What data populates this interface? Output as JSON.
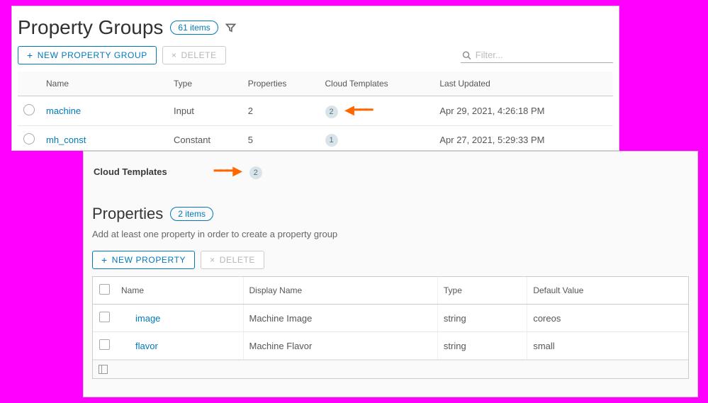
{
  "top": {
    "title": "Property Groups",
    "count_label": "61 items",
    "buttons": {
      "new_label": "NEW PROPERTY GROUP",
      "delete_label": "DELETE"
    },
    "filter_placeholder": "Filter...",
    "columns": {
      "name": "Name",
      "type": "Type",
      "props": "Properties",
      "templates": "Cloud Templates",
      "updated": "Last Updated"
    },
    "rows": [
      {
        "name": "machine",
        "type": "Input",
        "props": "2",
        "templates": "2",
        "updated": "Apr 29, 2021, 4:26:18 PM",
        "arrow": true
      },
      {
        "name": "mh_const",
        "type": "Constant",
        "props": "5",
        "templates": "1",
        "updated": "Apr 27, 2021, 5:29:33 PM",
        "arrow": false
      }
    ]
  },
  "detail": {
    "cloud_templates_label": "Cloud Templates",
    "cloud_templates_count": "2",
    "props_title": "Properties",
    "props_count_label": "2 items",
    "subtext": "Add at least one property in order to create a property group",
    "buttons": {
      "new_label": "NEW PROPERTY",
      "delete_label": "DELETE"
    },
    "columns": {
      "name": "Name",
      "display": "Display Name",
      "type": "Type",
      "default": "Default Value"
    },
    "rows": [
      {
        "name": "image",
        "display": "Machine Image",
        "type": "string",
        "default": "coreos"
      },
      {
        "name": "flavor",
        "display": "Machine Flavor",
        "type": "string",
        "default": "small"
      }
    ]
  }
}
